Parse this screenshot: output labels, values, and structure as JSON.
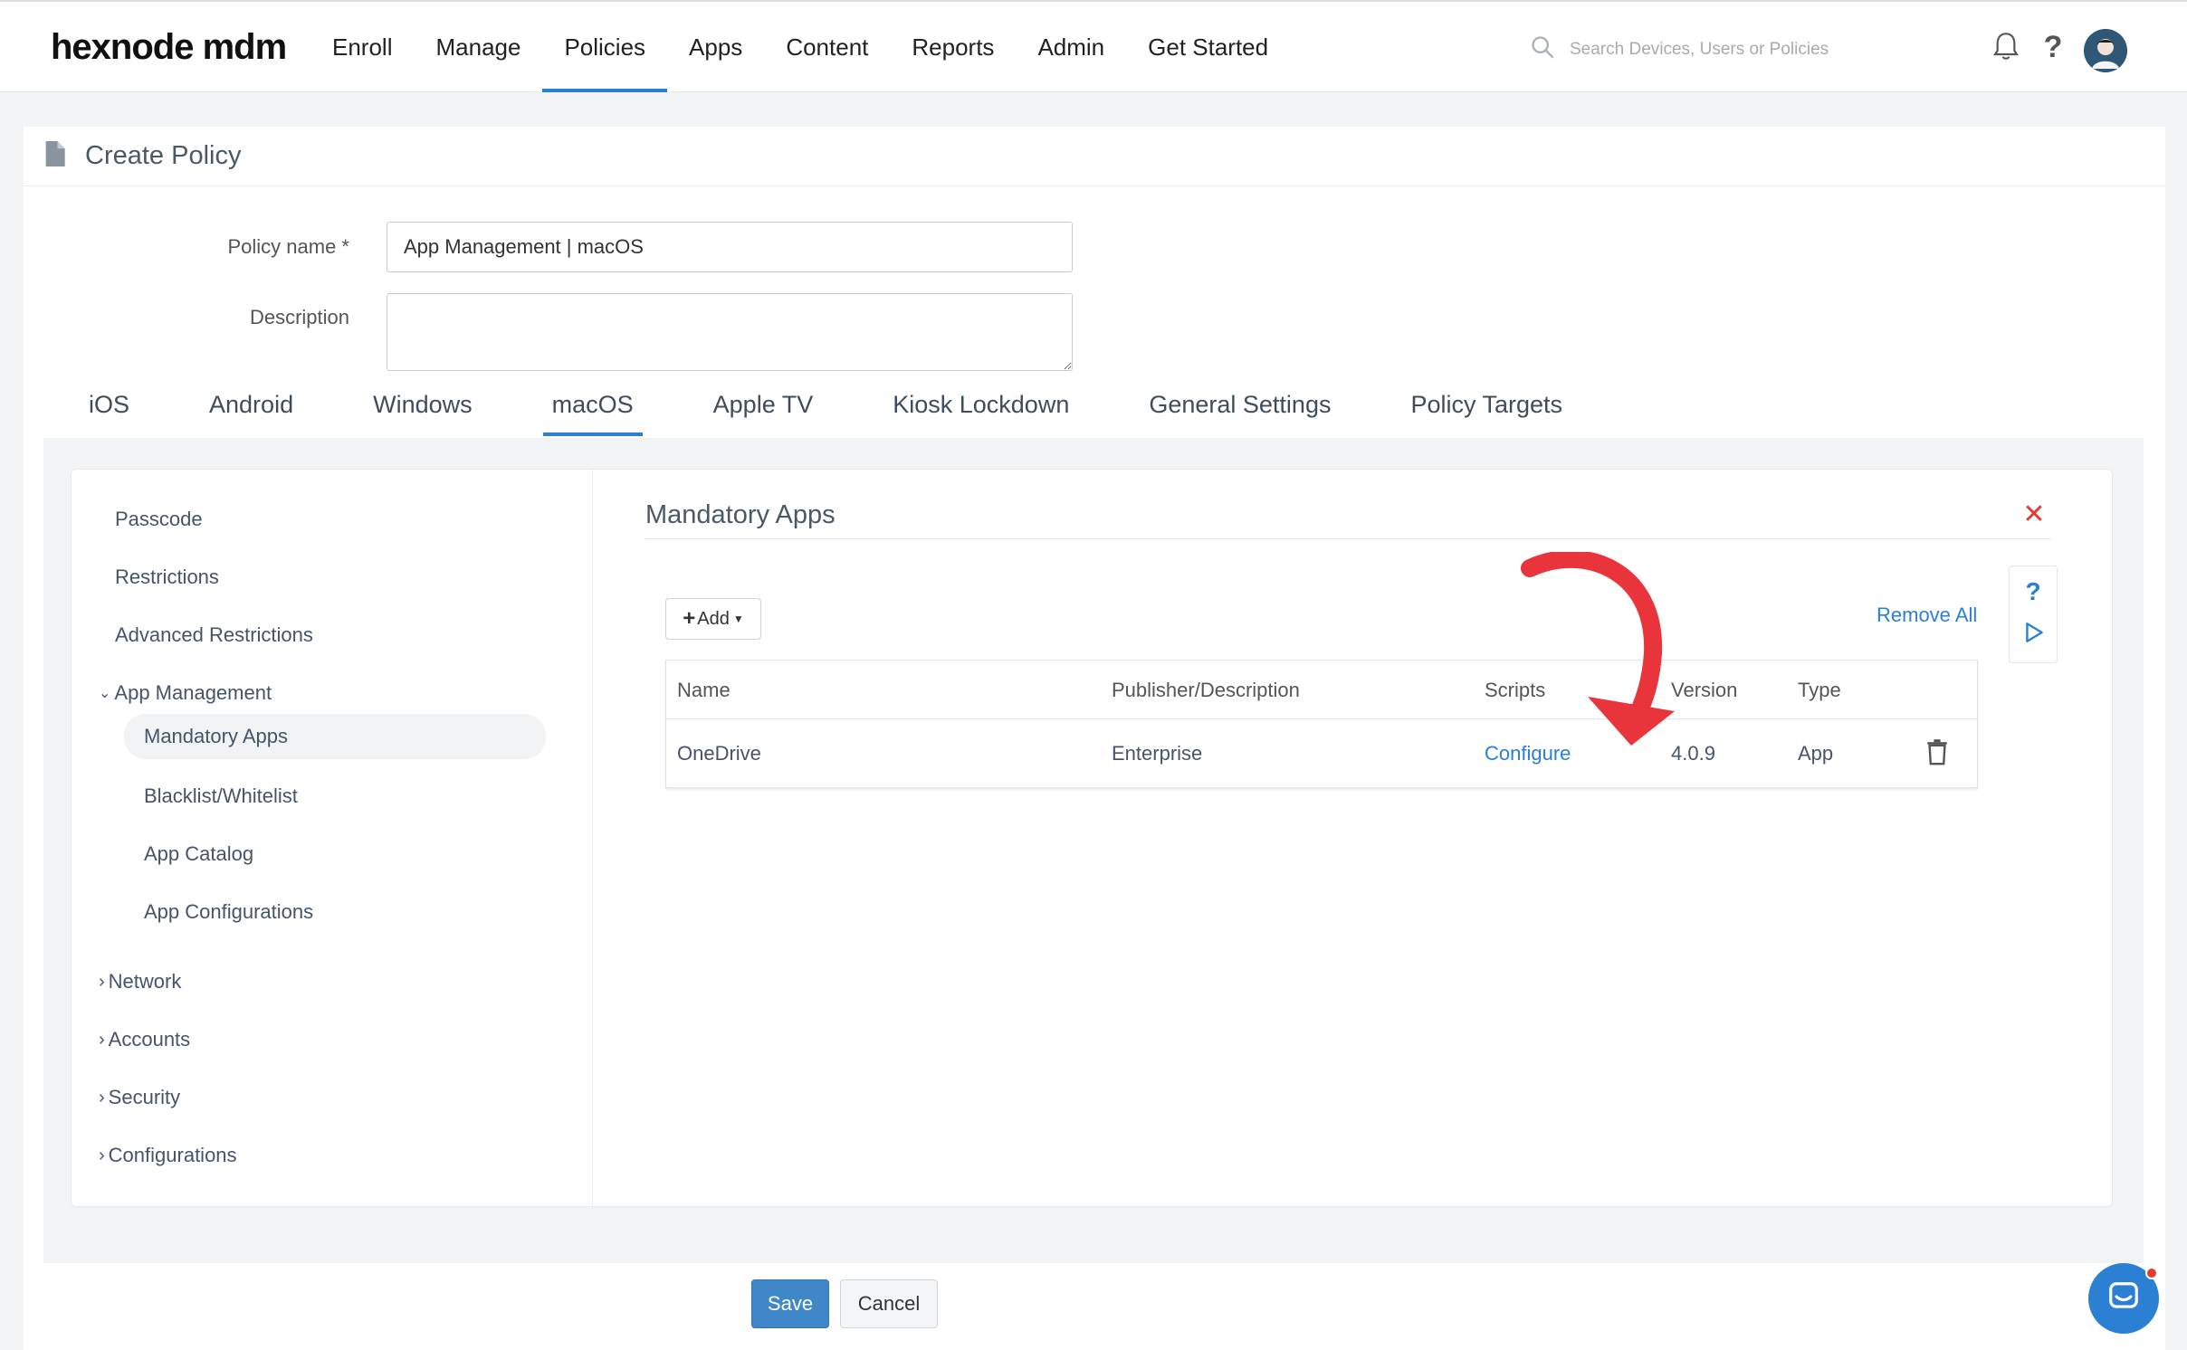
{
  "header": {
    "logo": "hexnode mdm",
    "nav": [
      {
        "label": "Enroll"
      },
      {
        "label": "Manage"
      },
      {
        "label": "Policies"
      },
      {
        "label": "Apps"
      },
      {
        "label": "Content"
      },
      {
        "label": "Reports"
      },
      {
        "label": "Admin"
      },
      {
        "label": "Get Started"
      }
    ],
    "active_nav": "Policies",
    "search_placeholder": "Search Devices, Users or Policies"
  },
  "page": {
    "title": "Create Policy",
    "policy_name_label": "Policy name *",
    "policy_name_value": "App Management | macOS",
    "description_label": "Description",
    "description_value": ""
  },
  "os_tabs": [
    {
      "label": "iOS"
    },
    {
      "label": "Android"
    },
    {
      "label": "Windows"
    },
    {
      "label": "macOS"
    },
    {
      "label": "Apple TV"
    },
    {
      "label": "Kiosk Lockdown"
    },
    {
      "label": "General Settings"
    },
    {
      "label": "Policy Targets"
    }
  ],
  "active_os_tab": "macOS",
  "sidebar": {
    "items": [
      {
        "label": "Passcode"
      },
      {
        "label": "Restrictions"
      },
      {
        "label": "Advanced Restrictions"
      },
      {
        "label": "App Management"
      },
      {
        "label": "Network"
      },
      {
        "label": "Accounts"
      },
      {
        "label": "Security"
      },
      {
        "label": "Configurations"
      }
    ],
    "app_management_children": [
      {
        "label": "Mandatory Apps"
      },
      {
        "label": "Blacklist/Whitelist"
      },
      {
        "label": "App Catalog"
      },
      {
        "label": "App Configurations"
      }
    ],
    "active_child": "Mandatory Apps"
  },
  "content": {
    "title": "Mandatory Apps",
    "add_label": "Add",
    "remove_all_label": "Remove All",
    "help_glyph": "?",
    "columns": [
      "Name",
      "Publisher/Description",
      "Scripts",
      "Version",
      "Type"
    ],
    "rows": [
      {
        "name": "OneDrive",
        "publisher": "Enterprise",
        "scripts": "Configure",
        "version": "4.0.9",
        "type": "App"
      }
    ]
  },
  "footer": {
    "save_label": "Save",
    "cancel_label": "Cancel"
  },
  "colors": {
    "accent": "#2b80d3",
    "danger": "#e53935",
    "annotation_arrow": "#e8343a"
  }
}
